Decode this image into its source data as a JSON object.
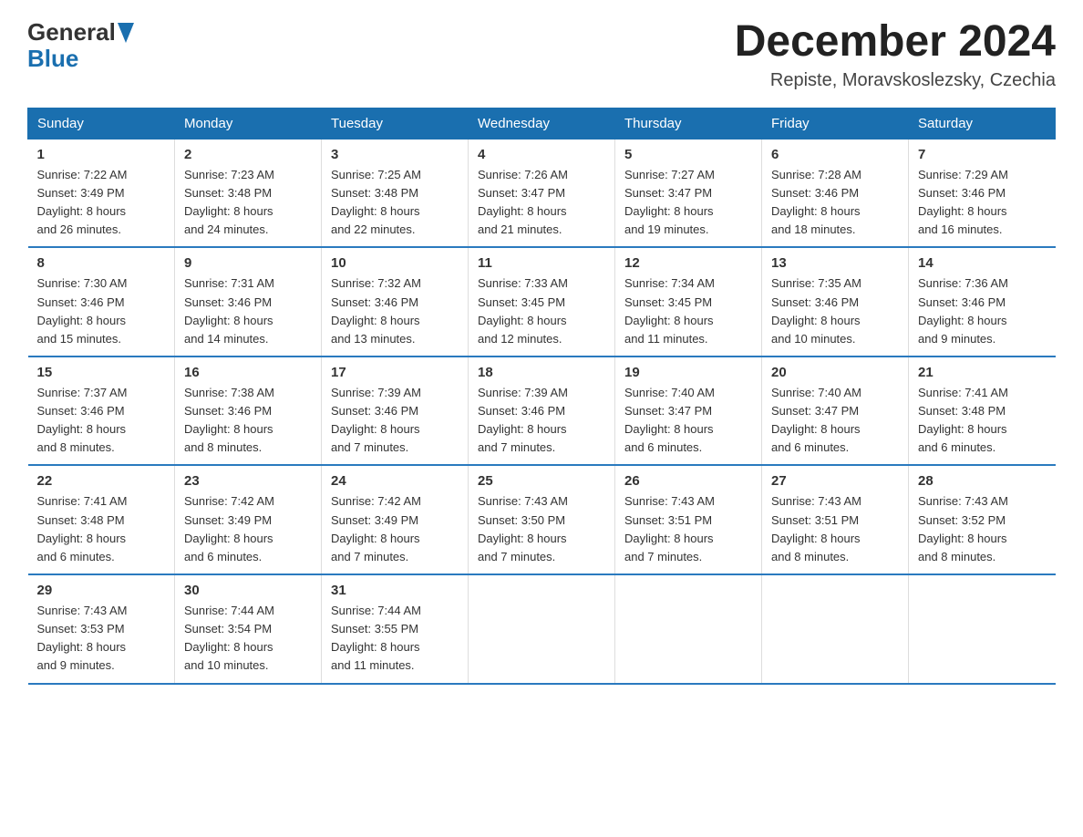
{
  "header": {
    "logo_general": "General",
    "logo_blue": "Blue",
    "month_title": "December 2024",
    "location": "Repiste, Moravskoslezsky, Czechia"
  },
  "days_of_week": [
    "Sunday",
    "Monday",
    "Tuesday",
    "Wednesday",
    "Thursday",
    "Friday",
    "Saturday"
  ],
  "weeks": [
    [
      {
        "day": "1",
        "sunrise": "7:22 AM",
        "sunset": "3:49 PM",
        "daylight": "8 hours and 26 minutes."
      },
      {
        "day": "2",
        "sunrise": "7:23 AM",
        "sunset": "3:48 PM",
        "daylight": "8 hours and 24 minutes."
      },
      {
        "day": "3",
        "sunrise": "7:25 AM",
        "sunset": "3:48 PM",
        "daylight": "8 hours and 22 minutes."
      },
      {
        "day": "4",
        "sunrise": "7:26 AM",
        "sunset": "3:47 PM",
        "daylight": "8 hours and 21 minutes."
      },
      {
        "day": "5",
        "sunrise": "7:27 AM",
        "sunset": "3:47 PM",
        "daylight": "8 hours and 19 minutes."
      },
      {
        "day": "6",
        "sunrise": "7:28 AM",
        "sunset": "3:46 PM",
        "daylight": "8 hours and 18 minutes."
      },
      {
        "day": "7",
        "sunrise": "7:29 AM",
        "sunset": "3:46 PM",
        "daylight": "8 hours and 16 minutes."
      }
    ],
    [
      {
        "day": "8",
        "sunrise": "7:30 AM",
        "sunset": "3:46 PM",
        "daylight": "8 hours and 15 minutes."
      },
      {
        "day": "9",
        "sunrise": "7:31 AM",
        "sunset": "3:46 PM",
        "daylight": "8 hours and 14 minutes."
      },
      {
        "day": "10",
        "sunrise": "7:32 AM",
        "sunset": "3:46 PM",
        "daylight": "8 hours and 13 minutes."
      },
      {
        "day": "11",
        "sunrise": "7:33 AM",
        "sunset": "3:45 PM",
        "daylight": "8 hours and 12 minutes."
      },
      {
        "day": "12",
        "sunrise": "7:34 AM",
        "sunset": "3:45 PM",
        "daylight": "8 hours and 11 minutes."
      },
      {
        "day": "13",
        "sunrise": "7:35 AM",
        "sunset": "3:46 PM",
        "daylight": "8 hours and 10 minutes."
      },
      {
        "day": "14",
        "sunrise": "7:36 AM",
        "sunset": "3:46 PM",
        "daylight": "8 hours and 9 minutes."
      }
    ],
    [
      {
        "day": "15",
        "sunrise": "7:37 AM",
        "sunset": "3:46 PM",
        "daylight": "8 hours and 8 minutes."
      },
      {
        "day": "16",
        "sunrise": "7:38 AM",
        "sunset": "3:46 PM",
        "daylight": "8 hours and 8 minutes."
      },
      {
        "day": "17",
        "sunrise": "7:39 AM",
        "sunset": "3:46 PM",
        "daylight": "8 hours and 7 minutes."
      },
      {
        "day": "18",
        "sunrise": "7:39 AM",
        "sunset": "3:46 PM",
        "daylight": "8 hours and 7 minutes."
      },
      {
        "day": "19",
        "sunrise": "7:40 AM",
        "sunset": "3:47 PM",
        "daylight": "8 hours and 6 minutes."
      },
      {
        "day": "20",
        "sunrise": "7:40 AM",
        "sunset": "3:47 PM",
        "daylight": "8 hours and 6 minutes."
      },
      {
        "day": "21",
        "sunrise": "7:41 AM",
        "sunset": "3:48 PM",
        "daylight": "8 hours and 6 minutes."
      }
    ],
    [
      {
        "day": "22",
        "sunrise": "7:41 AM",
        "sunset": "3:48 PM",
        "daylight": "8 hours and 6 minutes."
      },
      {
        "day": "23",
        "sunrise": "7:42 AM",
        "sunset": "3:49 PM",
        "daylight": "8 hours and 6 minutes."
      },
      {
        "day": "24",
        "sunrise": "7:42 AM",
        "sunset": "3:49 PM",
        "daylight": "8 hours and 7 minutes."
      },
      {
        "day": "25",
        "sunrise": "7:43 AM",
        "sunset": "3:50 PM",
        "daylight": "8 hours and 7 minutes."
      },
      {
        "day": "26",
        "sunrise": "7:43 AM",
        "sunset": "3:51 PM",
        "daylight": "8 hours and 7 minutes."
      },
      {
        "day": "27",
        "sunrise": "7:43 AM",
        "sunset": "3:51 PM",
        "daylight": "8 hours and 8 minutes."
      },
      {
        "day": "28",
        "sunrise": "7:43 AM",
        "sunset": "3:52 PM",
        "daylight": "8 hours and 8 minutes."
      }
    ],
    [
      {
        "day": "29",
        "sunrise": "7:43 AM",
        "sunset": "3:53 PM",
        "daylight": "8 hours and 9 minutes."
      },
      {
        "day": "30",
        "sunrise": "7:44 AM",
        "sunset": "3:54 PM",
        "daylight": "8 hours and 10 minutes."
      },
      {
        "day": "31",
        "sunrise": "7:44 AM",
        "sunset": "3:55 PM",
        "daylight": "8 hours and 11 minutes."
      },
      null,
      null,
      null,
      null
    ]
  ],
  "labels": {
    "sunrise": "Sunrise:",
    "sunset": "Sunset:",
    "daylight": "Daylight:"
  }
}
